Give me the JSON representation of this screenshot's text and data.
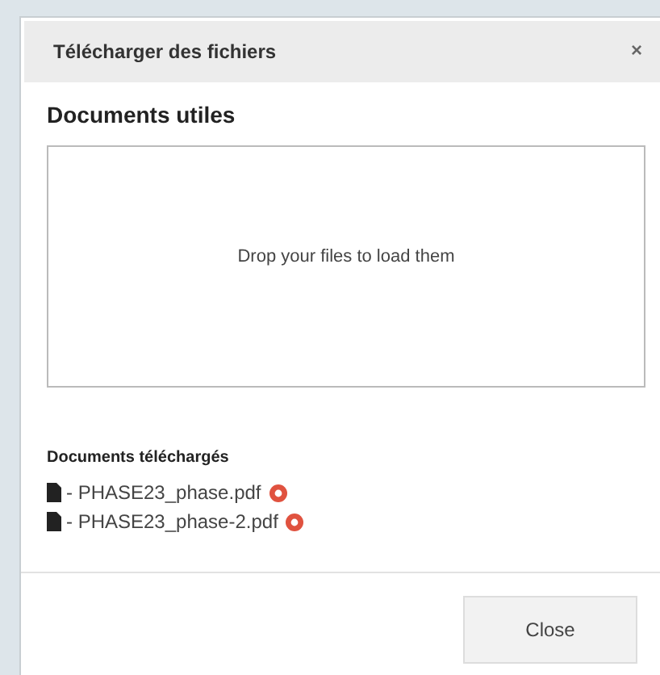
{
  "dialog": {
    "title": "Télécharger des fichiers",
    "close_icon": "×"
  },
  "section_title": "Documents utiles",
  "drop_zone": {
    "text": "Drop your files to load them"
  },
  "uploaded": {
    "title": "Documents téléchargés",
    "files": [
      {
        "name": "- PHASE23_phase.pdf"
      },
      {
        "name": "- PHASE23_phase-2.pdf"
      }
    ]
  },
  "buttons": [
    "Close"
  ]
}
